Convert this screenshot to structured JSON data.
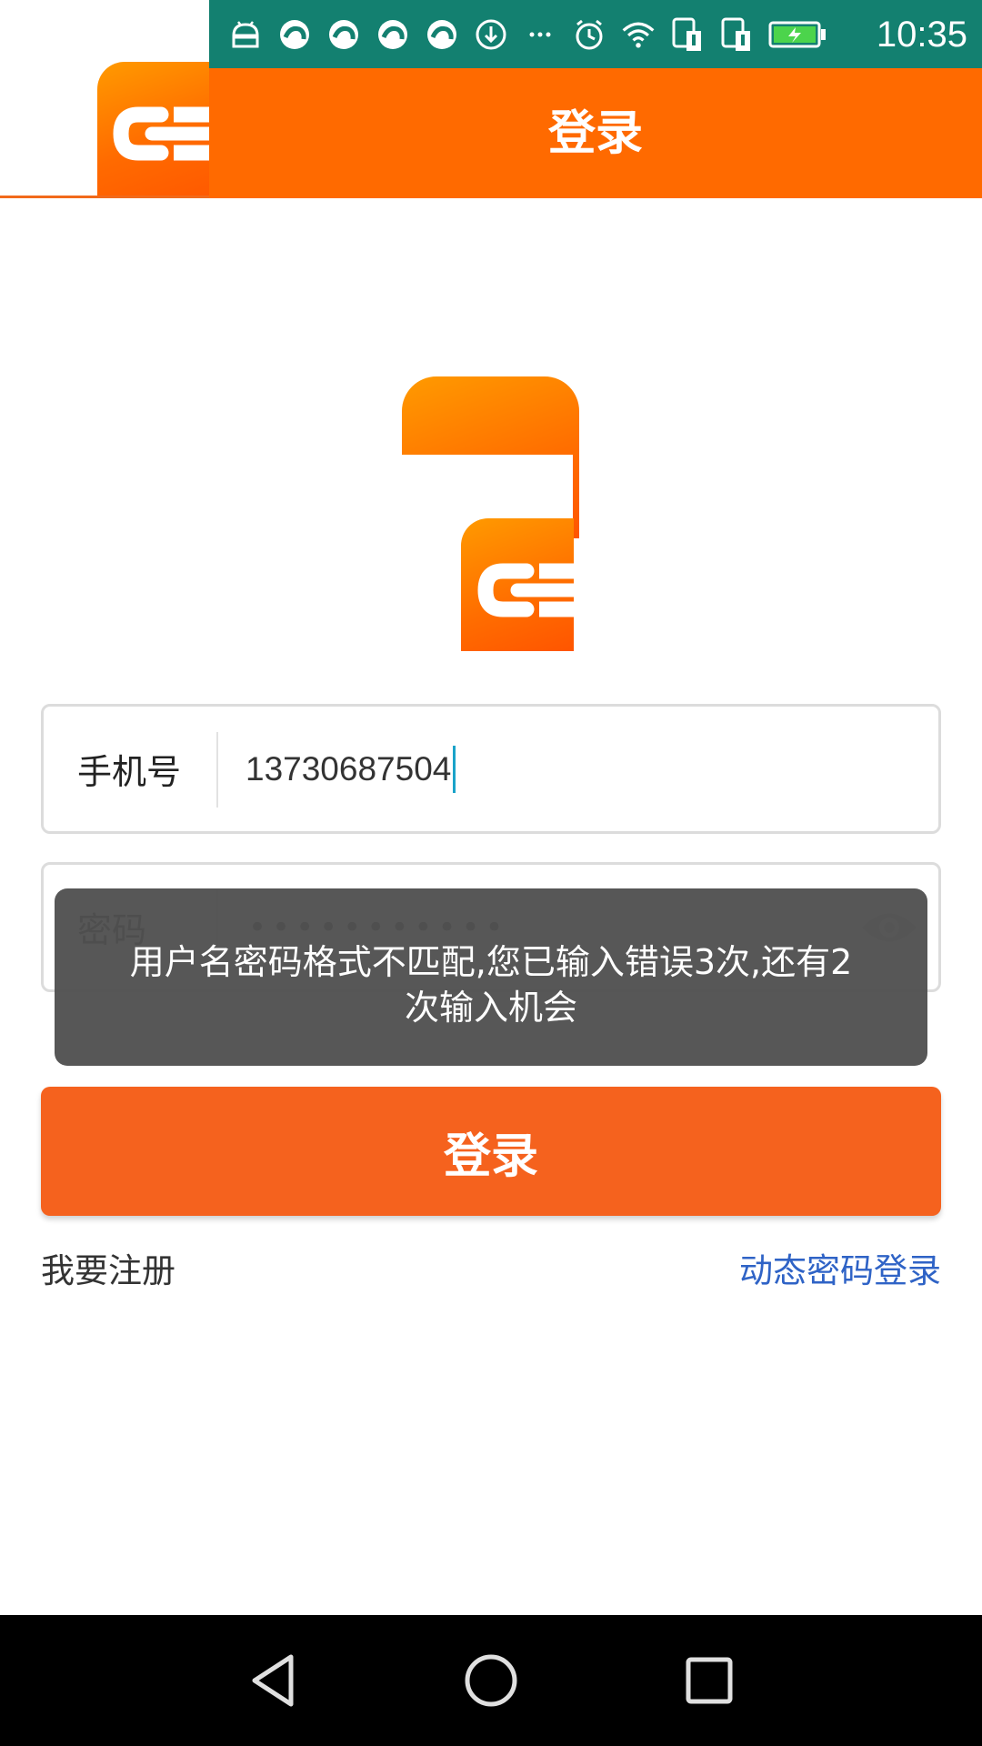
{
  "status_bar": {
    "time": "10:35",
    "icons": [
      "android-icon",
      "app-notification-icon",
      "app-notification-icon",
      "app-notification-icon",
      "app-notification-icon",
      "download-icon",
      "more-icon",
      "alarm-icon",
      "wifi-icon",
      "sim1-icon",
      "sim2-icon",
      "battery-charging-icon"
    ]
  },
  "header": {
    "title": "登录"
  },
  "form": {
    "phone_label": "手机号",
    "phone_value": "13730687504",
    "password_label": "密码",
    "password_value": "•••••••••••"
  },
  "toast": {
    "message": "用户名密码格式不匹配,您已输入错误3次,还有2次输入机会"
  },
  "actions": {
    "login_label": "登录",
    "register_label": "我要注册",
    "dynamic_login_label": "动态密码登录"
  },
  "colors": {
    "brand_orange": "#ff6a00",
    "status_bar": "#138070",
    "link_blue": "#2f63c6"
  }
}
